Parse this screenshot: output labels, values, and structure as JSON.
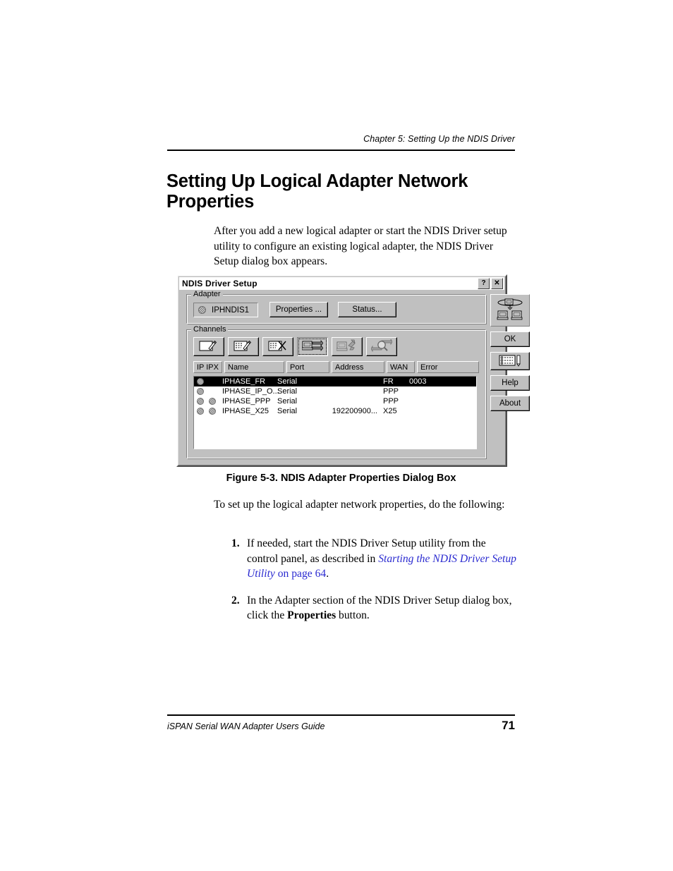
{
  "page": {
    "running_head": "Chapter 5: Setting Up the NDIS Driver",
    "heading": "Setting Up Logical Adapter Network Properties",
    "intro_paragraph": "After you add a new logical adapter or start the NDIS Driver setup utility to configure an existing logical adapter, the NDIS Driver Setup dialog box appears.",
    "figure_caption": "Figure 5-3.  NDIS Adapter Properties Dialog Box",
    "lead_in": "To set up the logical adapter network properties, do the following:",
    "steps": [
      {
        "number": "1.",
        "text_before": "If needed, start the NDIS Driver Setup utility from the control panel, as described in ",
        "link_italic": "Starting the NDIS Driver Setup Utility",
        "link_plain": " on page 64",
        "text_after": "."
      },
      {
        "number": "2.",
        "text_before": "In the Adapter section of the NDIS Driver Setup dialog box, click the ",
        "bold": "Properties",
        "text_after": " button."
      }
    ],
    "footer_left": "iSPAN Serial WAN Adapter Users Guide",
    "footer_page": "71",
    "link_color": "#2a2ad0"
  },
  "dialog": {
    "title": "NDIS Driver Setup",
    "titlebar_buttons": [
      {
        "name": "help-button",
        "glyph": "?"
      },
      {
        "name": "close-button",
        "glyph": "✕"
      }
    ],
    "adapter": {
      "group_label": "Adapter",
      "selected_adapter": "IPHNDIS1",
      "buttons": [
        {
          "name": "properties-button",
          "label": "Properties ...",
          "accel": "P"
        },
        {
          "name": "status-button",
          "label": "Status...",
          "accel": "S"
        }
      ]
    },
    "channels": {
      "group_label": "Channels",
      "toolbar": [
        {
          "name": "new-channel-icon",
          "state": "enabled"
        },
        {
          "name": "edit-channel-icon",
          "state": "enabled"
        },
        {
          "name": "delete-channel-icon",
          "state": "enabled"
        },
        {
          "name": "connect-channel-icon",
          "state": "pressed"
        },
        {
          "name": "disconnect-channel-icon",
          "state": "disabled"
        },
        {
          "name": "monitor-channel-icon",
          "state": "disabled"
        }
      ],
      "columns": [
        "IP IPX",
        "Name",
        "Port",
        "Address",
        "WAN",
        "Error"
      ],
      "rows": [
        {
          "ip": true,
          "ipx": false,
          "name": "IPHASE_FR",
          "port": "Serial",
          "address": "",
          "wan": "FR",
          "error": "0003",
          "selected": true
        },
        {
          "ip": true,
          "ipx": false,
          "name": "IPHASE_IP_O...",
          "port": "Serial",
          "address": "",
          "wan": "PPP",
          "error": "",
          "selected": false
        },
        {
          "ip": true,
          "ipx": true,
          "name": "IPHASE_PPP",
          "port": "Serial",
          "address": "",
          "wan": "PPP",
          "error": "",
          "selected": false
        },
        {
          "ip": true,
          "ipx": true,
          "name": "IPHASE_X25",
          "port": "Serial",
          "address": "192200900...",
          "wan": "X25",
          "error": "",
          "selected": false
        }
      ]
    },
    "right_buttons": [
      {
        "name": "adapter-network-icon",
        "label": "",
        "accel": ""
      },
      {
        "name": "ok-button",
        "label": "OK",
        "accel": "O"
      },
      {
        "name": "log-button",
        "label": "",
        "accel": ""
      },
      {
        "name": "help-button",
        "label": "Help",
        "accel": "H"
      },
      {
        "name": "about-button",
        "label": "About",
        "accel": "A"
      }
    ],
    "colors": {
      "face": "#c0c0c0",
      "selection": "#000000",
      "list_background": "#ffffff"
    }
  }
}
